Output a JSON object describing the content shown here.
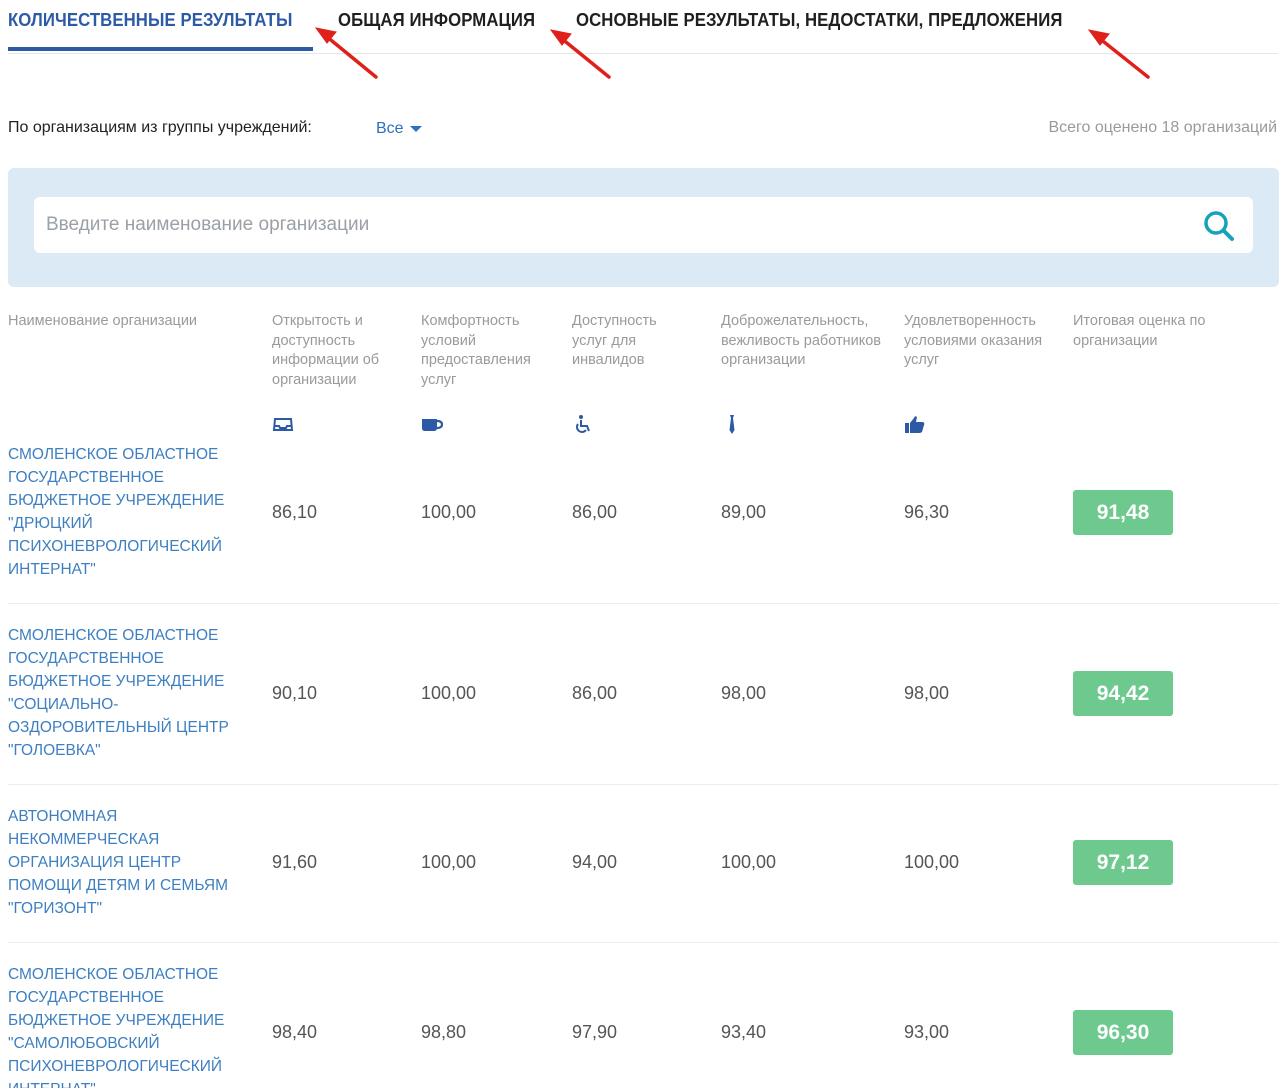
{
  "tabs": [
    {
      "label": "КОЛИЧЕСТВЕННЫЕ РЕЗУЛЬТАТЫ",
      "active": true
    },
    {
      "label": "ОБЩАЯ ИНФОРМАЦИЯ",
      "active": false
    },
    {
      "label": "ОСНОВНЫЕ РЕЗУЛЬТАТЫ, НЕДОСТАТКИ, ПРЕДЛОЖЕНИЯ",
      "active": false
    }
  ],
  "filter": {
    "label": "По организациям из группы учреждений:",
    "selected": "Все"
  },
  "total_text": "Всего оценено 18 организаций",
  "search": {
    "placeholder": "Введите наименование организации",
    "icon": "search-icon"
  },
  "table": {
    "headers": [
      {
        "label": "Наименование организации"
      },
      {
        "label": "Открытость и доступность информации об организации",
        "icon": "inbox-icon"
      },
      {
        "label": "Комфортность условий предоставления услуг",
        "icon": "coffee-cup-icon"
      },
      {
        "label": "Доступность услуг для инвалидов",
        "icon": "wheelchair-icon"
      },
      {
        "label": "Доброжелательность, вежливость работников организации",
        "icon": "tie-icon"
      },
      {
        "label": "Удовлетворенность условиями оказания услуг",
        "icon": "thumbs-up-icon"
      },
      {
        "label": "Итоговая оценка по организации"
      }
    ],
    "rows": [
      {
        "name": "СМОЛЕНСКОЕ ОБЛАСТНОЕ ГОСУДАРСТВЕННОЕ БЮДЖЕТНОЕ УЧРЕЖДЕНИЕ \"ДРЮЦКИЙ ПСИХОНЕВРОЛОГИЧЕСКИЙ ИНТЕРНАТ\"",
        "values": [
          "86,10",
          "100,00",
          "86,00",
          "89,00",
          "96,30"
        ],
        "score": "91,48"
      },
      {
        "name": "СМОЛЕНСКОЕ ОБЛАСТНОЕ ГОСУДАРСТВЕННОЕ БЮДЖЕТНОЕ УЧРЕЖДЕНИЕ \"СОЦИАЛЬНО-ОЗДОРОВИТЕЛЬНЫЙ ЦЕНТР \"ГОЛОЕВКА\"",
        "values": [
          "90,10",
          "100,00",
          "86,00",
          "98,00",
          "98,00"
        ],
        "score": "94,42"
      },
      {
        "name": "АВТОНОМНАЯ НЕКОММЕРЧЕСКАЯ ОРГАНИЗАЦИЯ ЦЕНТР ПОМОЩИ ДЕТЯМ И СЕМЬЯМ \"ГОРИЗОНТ\"",
        "values": [
          "91,60",
          "100,00",
          "94,00",
          "100,00",
          "100,00"
        ],
        "score": "97,12"
      },
      {
        "name": "СМОЛЕНСКОЕ ОБЛАСТНОЕ ГОСУДАРСТВЕННОЕ БЮДЖЕТНОЕ УЧРЕЖДЕНИЕ \"САМОЛЮБОВСКИЙ ПСИХОНЕВРОЛОГИЧЕСКИЙ ИНТЕРНАТ\"",
        "values": [
          "98,40",
          "98,80",
          "97,90",
          "93,40",
          "93,00"
        ],
        "score": "96,30"
      }
    ]
  },
  "colors": {
    "accent": "#2d5aa5",
    "link": "#3d7fc1",
    "score_bg": "#6dc98e",
    "search_band": "#dbeaf5",
    "annotation_arrow": "#e0201b"
  }
}
